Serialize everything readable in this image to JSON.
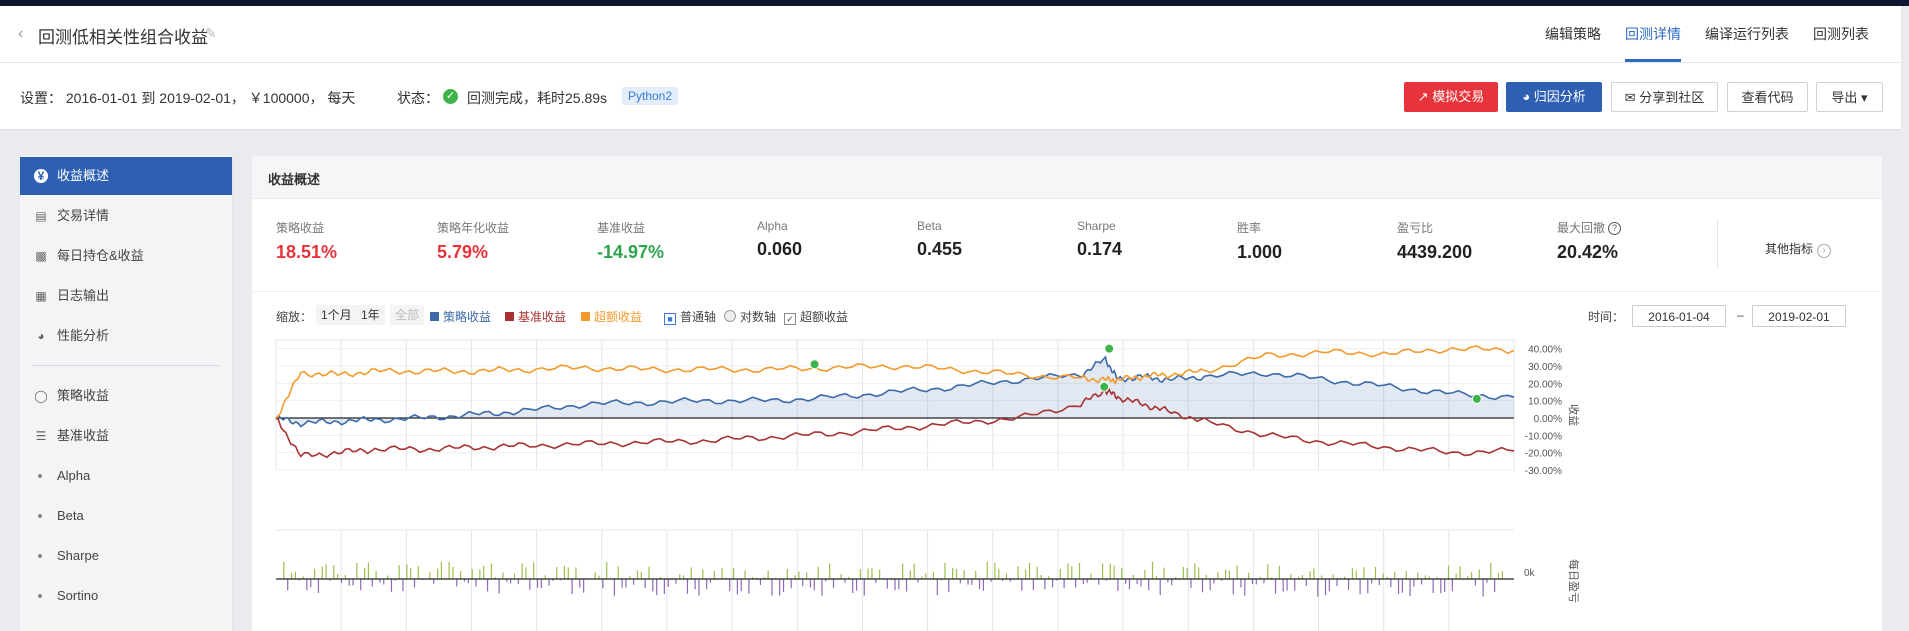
{
  "header": {
    "back_icon": "chevron-left-icon",
    "title": "回测低相关性组合收益",
    "edit_icon": "pencil-icon",
    "nav": [
      "编辑策略",
      "回测详情",
      "编译运行列表",
      "回测列表"
    ],
    "active_nav": "回测详情"
  },
  "settings": {
    "config": "设置： 2016-01-01 到 2019-02-01， ￥100000， 每天",
    "status_label": "状态：",
    "status_icon": "check-circle-icon",
    "status_text": "回测完成，耗时25.89s",
    "language_badge": "Python2",
    "buttons": {
      "sim_trade": "模拟交易",
      "attribution": "归因分析",
      "share": "分享到社区",
      "view_code": "查看代码",
      "export": "导出"
    }
  },
  "sidebar": {
    "items": [
      {
        "label": "收益概述",
        "icon": "yen-circle-icon",
        "active": true
      },
      {
        "label": "交易详情",
        "icon": "document-icon"
      },
      {
        "label": "每日持仓&收益",
        "icon": "bar-chart-icon"
      },
      {
        "label": "日志输出",
        "icon": "calendar-icon"
      },
      {
        "label": "性能分析",
        "icon": "pie-chart-icon"
      }
    ],
    "metric_items": [
      {
        "label": "策略收益",
        "icon": "lightbulb-icon"
      },
      {
        "label": "基准收益",
        "icon": "database-icon"
      },
      {
        "label": "Alpha"
      },
      {
        "label": "Beta"
      },
      {
        "label": "Sharpe"
      },
      {
        "label": "Sortino"
      }
    ]
  },
  "panel": {
    "title": "收益概述",
    "metrics": [
      {
        "label": "策略收益",
        "value": "18.51%"
      },
      {
        "label": "策略年化收益",
        "value": "5.79%"
      },
      {
        "label": "基准收益",
        "value": "-14.97%"
      },
      {
        "label": "Alpha",
        "value": "0.060"
      },
      {
        "label": "Beta",
        "value": "0.455"
      },
      {
        "label": "Sharpe",
        "value": "0.174"
      },
      {
        "label": "胜率",
        "value": "1.000"
      },
      {
        "label": "盈亏比",
        "value": "4439.200"
      },
      {
        "label": "最大回撤",
        "value": "20.42%"
      }
    ],
    "other_metrics": "其他指标",
    "controls": {
      "zoom_label": "缩放：",
      "zoom_options": [
        "1个月",
        "1年",
        "全部"
      ],
      "legend": [
        "策略收益",
        "基准收益",
        "超额收益"
      ],
      "axis_normal": "普通轴",
      "axis_log": "对数轴",
      "excess": "超额收益",
      "time_label": "时间：",
      "date_from": "2016-01-04",
      "date_sep": "–",
      "date_to": "2019-02-01"
    },
    "colors": {
      "strategy": "#3c6aa8",
      "benchmark": "#a83232",
      "excess": "#f39a2b"
    }
  },
  "chart_data": {
    "type": "line",
    "ylabel": "收益",
    "y_ticks": [
      "40.00%",
      "30.00%",
      "20.00%",
      "10.00%",
      "0.00%",
      "-10.00%",
      "-20.00%",
      "-30.00%"
    ],
    "ylim": [
      -30,
      45
    ],
    "x": [
      0,
      2,
      5,
      8,
      12,
      16,
      20,
      25,
      30,
      35,
      40,
      45,
      50,
      55,
      60,
      65,
      67,
      68,
      70,
      72,
      75,
      80,
      85,
      90,
      95,
      100
    ],
    "series": [
      {
        "name": "策略收益",
        "values": [
          0,
          -3,
          -2,
          -1,
          0,
          2,
          4,
          8,
          9,
          10,
          10,
          12,
          15,
          18,
          22,
          25,
          34,
          22,
          24,
          22,
          24,
          26,
          22,
          18,
          14,
          12
        ]
      },
      {
        "name": "基准收益",
        "values": [
          0,
          -22,
          -20,
          -18,
          -18,
          -17,
          -16,
          -15,
          -14,
          -13,
          -11,
          -9,
          -6,
          -3,
          0,
          8,
          16,
          12,
          8,
          4,
          -2,
          -10,
          -14,
          -17,
          -20,
          -19
        ]
      },
      {
        "name": "超额收益",
        "values": [
          0,
          26,
          25,
          27,
          27,
          27,
          28,
          29,
          28,
          28,
          28,
          29,
          30,
          28,
          25,
          23,
          22,
          22,
          24,
          25,
          27,
          36,
          38,
          37,
          40,
          39
        ]
      }
    ],
    "markers": [
      {
        "series": "超额收益",
        "x": 43.5,
        "y": 31
      },
      {
        "series": "策略收益",
        "x": 67.3,
        "y": 40
      },
      {
        "series": "策略收益",
        "x": 66.9,
        "y": 18
      },
      {
        "series": "策略收益",
        "x": 97,
        "y": 11
      }
    ],
    "daily_ylabel": "每日盈亏",
    "daily_tick": "0k"
  }
}
